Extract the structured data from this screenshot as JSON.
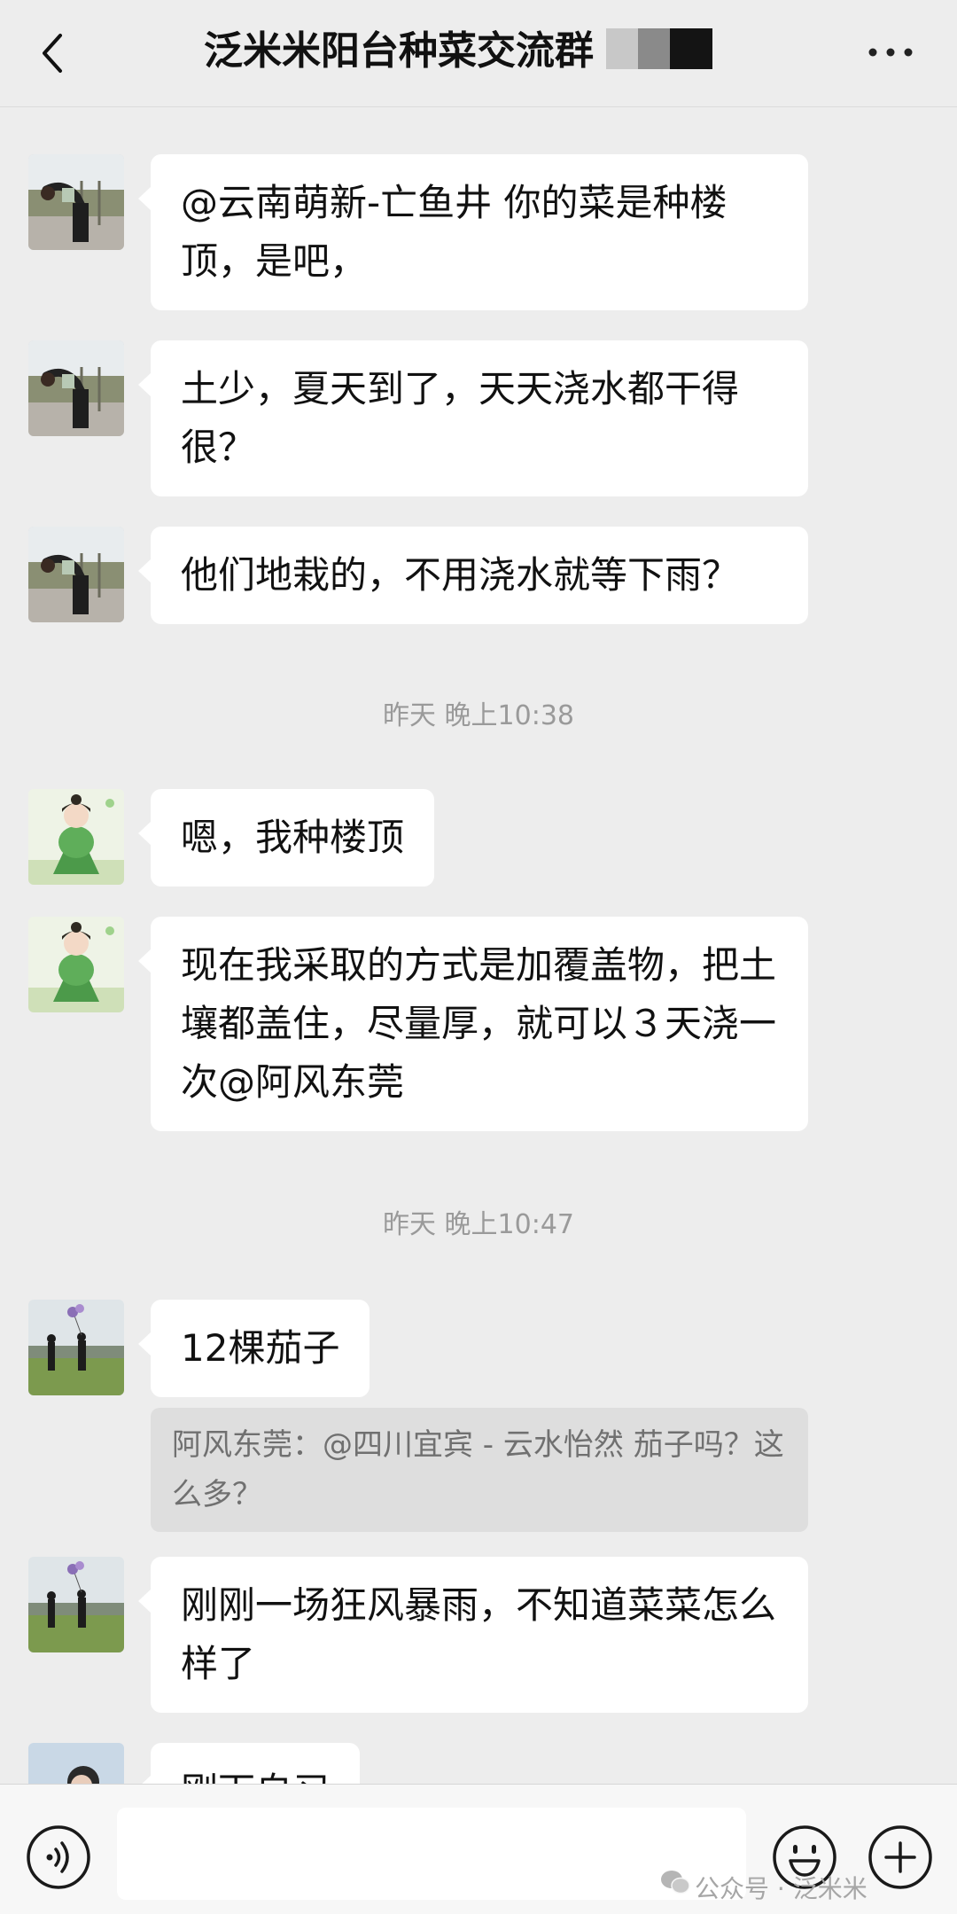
{
  "header": {
    "title": "泛米米阳台种菜交流群"
  },
  "messages": [
    {
      "text": "@云南萌新-亡鱼井  你的菜是种楼顶，是吧，",
      "avatar": "user-avatar-stretching-woman"
    },
    {
      "text": "土少，夏天到了，天天浇水都干得很？",
      "avatar": "user-avatar-stretching-woman"
    },
    {
      "text": "他们地栽的，不用浇水就等下雨？",
      "avatar": "user-avatar-stretching-woman"
    },
    {
      "time": "昨天 晚上10:38"
    },
    {
      "text": "嗯，我种楼顶",
      "avatar": "user-avatar-green-dress-girl"
    },
    {
      "text": "现在我采取的方式是加覆盖物，把土壤都盖住，尽量厚，就可以３天浇一次@阿风东莞",
      "avatar": "user-avatar-green-dress-girl"
    },
    {
      "time": "昨天 晚上10:47"
    },
    {
      "text": "12棵茄子",
      "avatar": "user-avatar-balloons-field",
      "quote": "阿风东莞：@四川宜宾 - 云水怡然 茄子吗？这么多？"
    },
    {
      "text": "刚刚一场狂风暴雨，不知道菜菜怎么样了",
      "avatar": "user-avatar-balloons-field"
    },
    {
      "text": "刚下自习",
      "avatar": "user-avatar-portrait-girl"
    }
  ],
  "footer": {
    "input_placeholder": "",
    "watermark": "公众号 · 泛米米"
  },
  "colors": {
    "background": "#ededed",
    "bubble": "#ffffff",
    "quote_bg": "#dedede",
    "time_text": "#9a9a9a"
  }
}
